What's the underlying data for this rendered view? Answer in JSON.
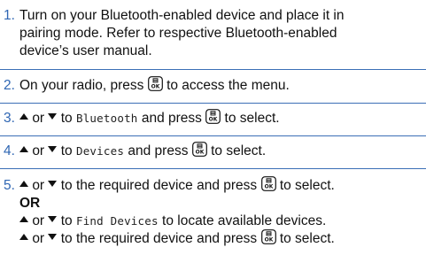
{
  "steps": [
    {
      "number": "1.",
      "lines": [
        "Turn on your Bluetooth-enabled device and place it in",
        "pairing mode. Refer to respective Bluetooth-enabled",
        "device’s user manual."
      ]
    },
    {
      "number": "2.",
      "before": "On your radio, press",
      "after": "to access the menu."
    },
    {
      "number": "3.",
      "or_word": "or",
      "to_word": "to",
      "menu_item": "Bluetooth",
      "after": "and press",
      "end": "to select."
    },
    {
      "number": "4.",
      "or_word": "or",
      "to_word": "to",
      "menu_item": "Devices",
      "after": "and press",
      "end": "to select."
    },
    {
      "number": "5.",
      "line1": {
        "or_word": "or",
        "text": "to the required device and press",
        "end": "to select."
      },
      "or_label": "OR",
      "line3": {
        "or_word": "or",
        "to_word": "to",
        "menu_item": "Find Devices",
        "text": "to locate available devices."
      },
      "line4": {
        "or_word": "or",
        "text": "to the required device and press",
        "end": "to select."
      }
    }
  ],
  "icons": {
    "up": "triangle-up-icon",
    "down": "triangle-down-icon",
    "ok_key": "menu-ok-button-icon"
  },
  "colors": {
    "step_number": "#2f66b3",
    "divider": "#3b6fb6"
  }
}
